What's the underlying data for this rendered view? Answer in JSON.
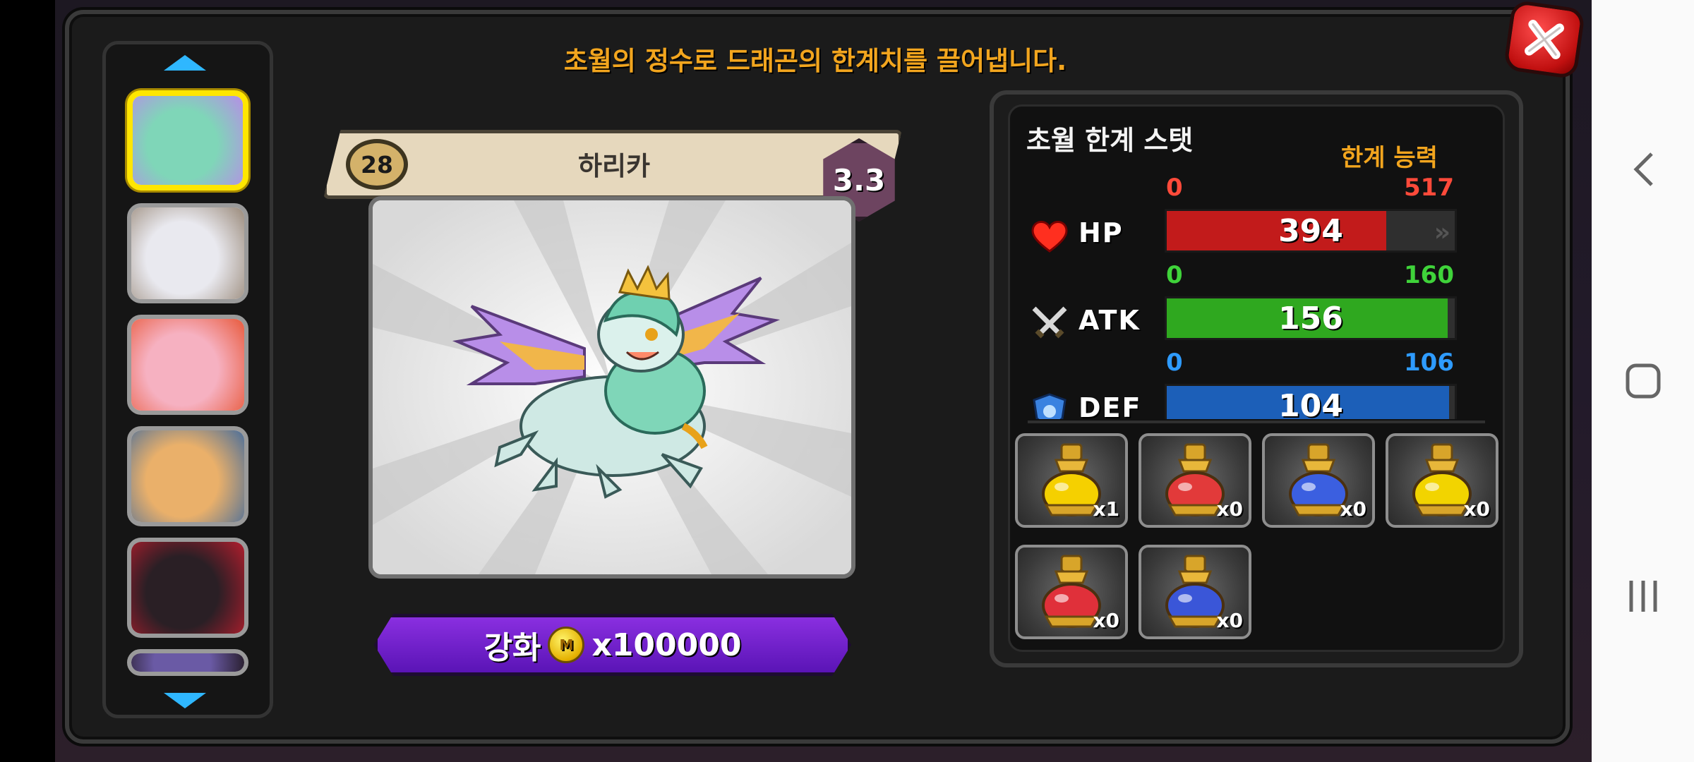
{
  "header": {
    "description": "초월의 정수로 드래곤의 한계치를 끌어냅니다."
  },
  "dragon": {
    "level": "28",
    "name": "하리카",
    "grade": "3.3"
  },
  "enhance": {
    "label": "강화",
    "coin_symbol": "M",
    "cost": "x100000"
  },
  "stats": {
    "title": "초월 한계 스탯",
    "limit_label": "한계 능력",
    "rows": [
      {
        "key": "hp",
        "label": "HP",
        "min": "0",
        "max": "517",
        "value": "394",
        "fraction": 0.762,
        "color": "#c21b1b",
        "label_color": "#ff4a3a"
      },
      {
        "key": "atk",
        "label": "ATK",
        "min": "0",
        "max": "160",
        "value": "156",
        "fraction": 0.975,
        "color": "#2fa81f",
        "label_color": "#3fd33a"
      },
      {
        "key": "def",
        "label": "DEF",
        "min": "0",
        "max": "106",
        "value": "104",
        "fraction": 0.981,
        "color": "#1c5fb8",
        "label_color": "#2e9bff"
      }
    ]
  },
  "items": [
    {
      "name": "gold-potion",
      "qty": "x1",
      "color": "#f5d000"
    },
    {
      "name": "red-potion",
      "qty": "x0",
      "color": "#e23a3a"
    },
    {
      "name": "blue-potion",
      "qty": "x0",
      "color": "#3b5fe0"
    },
    {
      "name": "large-gold-potion",
      "qty": "x0",
      "color": "#f2d400"
    },
    {
      "name": "large-red-potion",
      "qty": "x0",
      "color": "#e0303a"
    },
    {
      "name": "large-blue-potion",
      "qty": "x0",
      "color": "#3a56d8"
    }
  ],
  "dragon_list": [
    {
      "name": "dragon-thumb-green-crowned",
      "colors": [
        "#7fd6b8",
        "#b68ee6"
      ],
      "selected": true
    },
    {
      "name": "dragon-thumb-white-horned",
      "colors": [
        "#e9e9ef",
        "#9a8a7a"
      ],
      "selected": false
    },
    {
      "name": "dragon-thumb-pink-fairy",
      "colors": [
        "#f6b1c1",
        "#e85a3c"
      ],
      "selected": false
    },
    {
      "name": "dragon-thumb-orange-furry",
      "colors": [
        "#eab06a",
        "#4a6e9a"
      ],
      "selected": false
    },
    {
      "name": "dragon-thumb-dark-red",
      "colors": [
        "#2a1f25",
        "#b21d2d"
      ],
      "selected": false
    },
    {
      "name": "dragon-thumb-partial",
      "colors": [
        "#6a5aa5",
        "#2a2030"
      ],
      "selected": false
    }
  ]
}
